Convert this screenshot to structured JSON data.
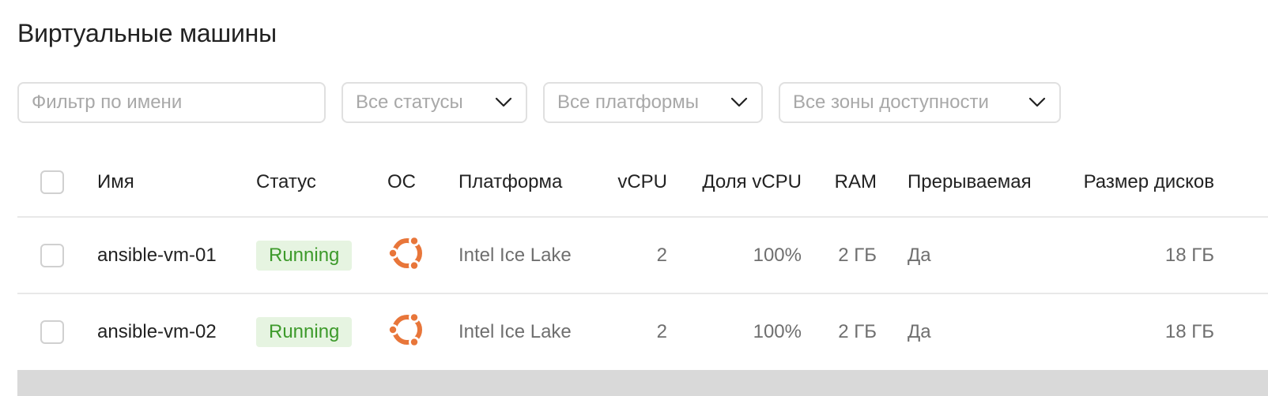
{
  "page": {
    "title": "Виртуальные машины"
  },
  "filters": {
    "name_placeholder": "Фильтр по имени",
    "status_value": "Все статусы",
    "platform_value": "Все платформы",
    "zone_value": "Все зоны доступности"
  },
  "table": {
    "columns": {
      "name": "Имя",
      "status": "Статус",
      "os": "ОС",
      "platform": "Платформа",
      "vcpu": "vCPU",
      "vcpu_share": "Доля vCPU",
      "ram": "RAM",
      "preemptible": "Прерываемая",
      "disk_size": "Размер дисков"
    },
    "rows": [
      {
        "name": "ansible-vm-01",
        "status": "Running",
        "os_icon": "ubuntu-icon",
        "platform": "Intel Ice Lake",
        "vcpu": "2",
        "vcpu_share": "100%",
        "ram": "2 ГБ",
        "preemptible": "Да",
        "disk_size": "18 ГБ"
      },
      {
        "name": "ansible-vm-02",
        "status": "Running",
        "os_icon": "ubuntu-icon",
        "platform": "Intel Ice Lake",
        "vcpu": "2",
        "vcpu_share": "100%",
        "ram": "2 ГБ",
        "preemptible": "Да",
        "disk_size": "18 ГБ"
      }
    ]
  },
  "colors": {
    "status_running_bg": "#e6f4e1",
    "status_running_text": "#3d9a2b",
    "ubuntu_orange": "#e8763a"
  }
}
